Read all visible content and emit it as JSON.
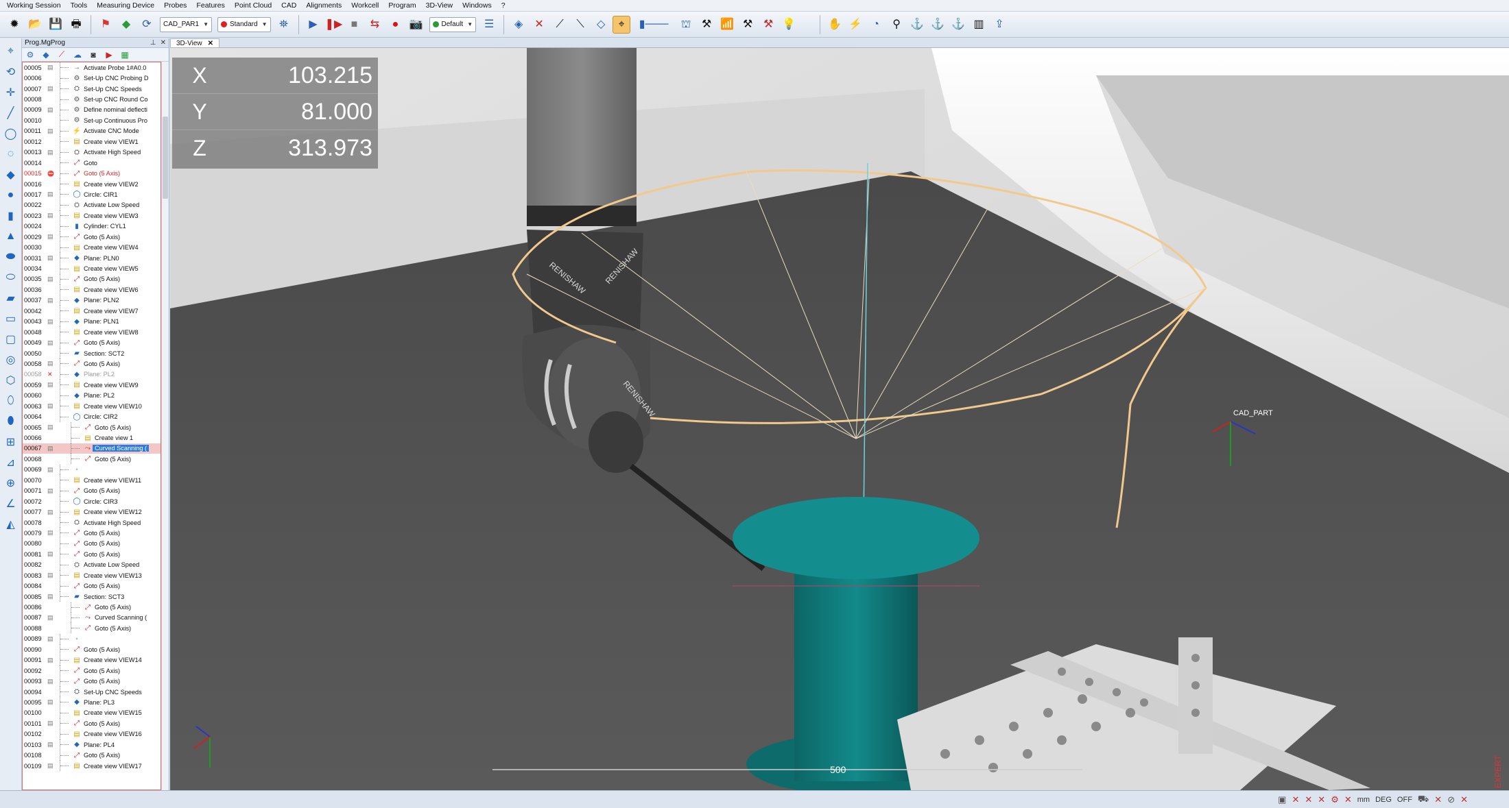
{
  "menu": [
    "Working Session",
    "Tools",
    "Measuring Device",
    "Probes",
    "Features",
    "Point Cloud",
    "CAD",
    "Alignments",
    "Workcell",
    "Program",
    "3D-View",
    "Windows",
    "?"
  ],
  "toolbar": {
    "cad_combo": "CAD_PAR1",
    "mode_combo": "Standard",
    "view_combo": "Default"
  },
  "tree": {
    "title": "Prog.MgProg",
    "rows": [
      {
        "n": "00005",
        "t": "Activate Probe 1#A0.0"
      },
      {
        "n": "00006",
        "t": "Set-Up CNC Probing D"
      },
      {
        "n": "00007",
        "t": "Set-Up CNC Speeds"
      },
      {
        "n": "00008",
        "t": "Set-up CNC Round Co"
      },
      {
        "n": "00009",
        "t": "Define nominal deflecti"
      },
      {
        "n": "00010",
        "t": "Set-up Continuous Pro"
      },
      {
        "n": "00011",
        "t": "Activate CNC Mode"
      },
      {
        "n": "00012",
        "t": "Create view VIEW1"
      },
      {
        "n": "00013",
        "t": "Activate High Speed"
      },
      {
        "n": "00014",
        "t": "Goto"
      },
      {
        "n": "00015",
        "t": "Goto (5 Axis)"
      },
      {
        "n": "00016",
        "t": "Create view VIEW2"
      },
      {
        "n": "00017",
        "t": "Circle: CIR1"
      },
      {
        "n": "00022",
        "t": "Activate Low Speed"
      },
      {
        "n": "00023",
        "t": "Create view VIEW3"
      },
      {
        "n": "00024",
        "t": "Cylinder: CYL1"
      },
      {
        "n": "00029",
        "t": "Goto (5 Axis)"
      },
      {
        "n": "00030",
        "t": "Create view VIEW4"
      },
      {
        "n": "00031",
        "t": "Plane: PLN0"
      },
      {
        "n": "00034",
        "t": "Create view VIEW5"
      },
      {
        "n": "00035",
        "t": "Goto (5 Axis)"
      },
      {
        "n": "00036",
        "t": "Create view VIEW6"
      },
      {
        "n": "00037",
        "t": "Plane: PLN2"
      },
      {
        "n": "00042",
        "t": "Create view VIEW7"
      },
      {
        "n": "00043",
        "t": "Plane: PLN1"
      },
      {
        "n": "00048",
        "t": "Create view VIEW8"
      },
      {
        "n": "00049",
        "t": "Goto (5 Axis)"
      },
      {
        "n": "00050",
        "t": "Section: SCT2"
      },
      {
        "n": "00058",
        "t": "Goto (5 Axis)"
      },
      {
        "n": "00058",
        "t": "Plane: PL2"
      },
      {
        "n": "00059",
        "t": "Create view VIEW9"
      },
      {
        "n": "00060",
        "t": "Plane: PL2"
      },
      {
        "n": "00063",
        "t": "Create view VIEW10"
      },
      {
        "n": "00064",
        "t": "Circle: CIR2"
      },
      {
        "n": "00065",
        "t": "Goto (5 Axis)"
      },
      {
        "n": "00066",
        "t": "Create view 1"
      },
      {
        "n": "00067",
        "t": "Curved Scanning ("
      },
      {
        "n": "00068",
        "t": "Goto (5 Axis)"
      },
      {
        "n": "00069",
        "t": ""
      },
      {
        "n": "00070",
        "t": "Create view VIEW11"
      },
      {
        "n": "00071",
        "t": "Goto (5 Axis)"
      },
      {
        "n": "00072",
        "t": "Circle: CIR3"
      },
      {
        "n": "00077",
        "t": "Create view VIEW12"
      },
      {
        "n": "00078",
        "t": "Activate High Speed"
      },
      {
        "n": "00079",
        "t": "Goto (5 Axis)"
      },
      {
        "n": "00080",
        "t": "Goto (5 Axis)"
      },
      {
        "n": "00081",
        "t": "Goto (5 Axis)"
      },
      {
        "n": "00082",
        "t": "Activate Low Speed"
      },
      {
        "n": "00083",
        "t": "Create view VIEW13"
      },
      {
        "n": "00084",
        "t": "Goto (5 Axis)"
      },
      {
        "n": "00085",
        "t": "Section: SCT3"
      },
      {
        "n": "00086",
        "t": "Goto (5 Axis)"
      },
      {
        "n": "00087",
        "t": "Curved Scanning ("
      },
      {
        "n": "00088",
        "t": "Goto (5 Axis)"
      },
      {
        "n": "00089",
        "t": ""
      },
      {
        "n": "00090",
        "t": "Goto (5 Axis)"
      },
      {
        "n": "00091",
        "t": "Create view VIEW14"
      },
      {
        "n": "00092",
        "t": "Goto (5 Axis)"
      },
      {
        "n": "00093",
        "t": "Goto (5 Axis)"
      },
      {
        "n": "00094",
        "t": "Set-Up CNC Speeds"
      },
      {
        "n": "00095",
        "t": "Plane: PL3"
      },
      {
        "n": "00100",
        "t": "Create view VIEW15"
      },
      {
        "n": "00101",
        "t": "Goto (5 Axis)"
      },
      {
        "n": "00102",
        "t": "Create view VIEW16"
      },
      {
        "n": "00103",
        "t": "Plane: PL4"
      },
      {
        "n": "00108",
        "t": "Goto (5 Axis)"
      },
      {
        "n": "00109",
        "t": "Create view VIEW17"
      }
    ]
  },
  "viewtab": "3D-View",
  "dro": {
    "x_label": "X",
    "x": "103.215",
    "y_label": "Y",
    "y": "81.000",
    "z_label": "Z",
    "z": "313.973"
  },
  "scene": {
    "cad_part_label": "CAD_PART",
    "scale_label": "500",
    "brand_text": "RENISHAW",
    "watermark": "EXPERT"
  },
  "status": {
    "unit": "mm",
    "angle": "DEG",
    "state": "OFF"
  }
}
